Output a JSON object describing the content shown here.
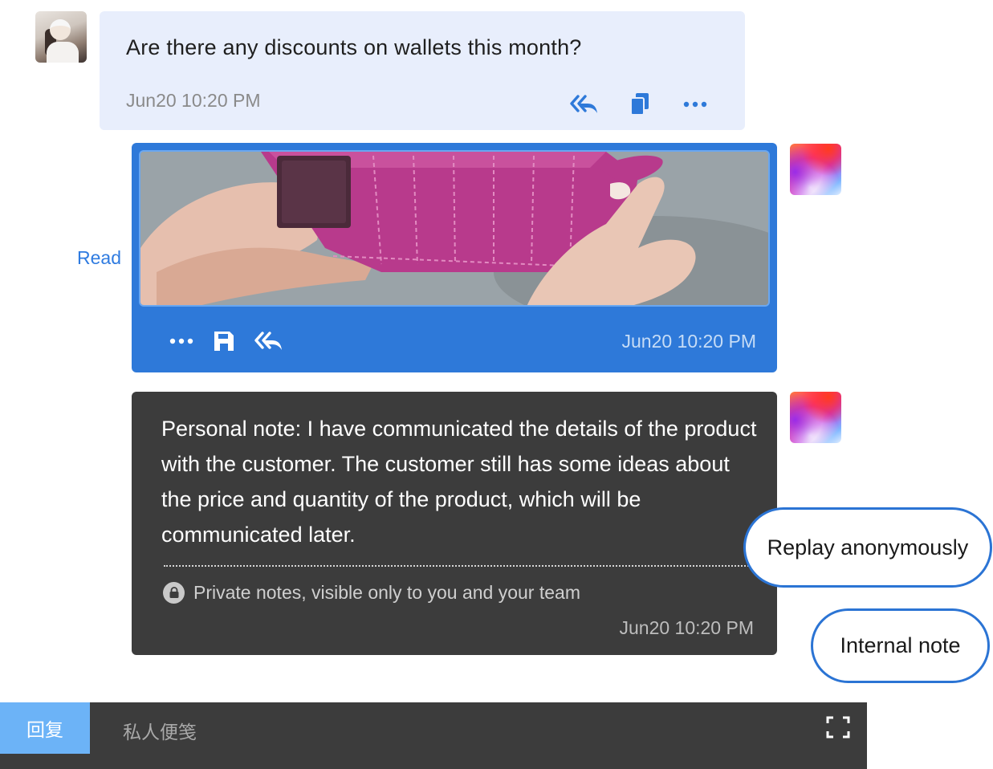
{
  "customer_message": {
    "text": "Are there any discounts on wallets this month?",
    "time": "Jun20 10:20 PM",
    "actions": [
      "reply-all-icon",
      "copy-icon",
      "more-icon"
    ]
  },
  "status": {
    "read": "Read"
  },
  "image_message": {
    "time": "Jun20 10:20 PM",
    "actions": [
      "more-icon",
      "save-icon",
      "reply-all-icon"
    ],
    "accent_color": "#2e79d9"
  },
  "note_message": {
    "text": "Personal note: I have communicated the details of the product with the customer. The customer still has some ideas about the price and quantity of the product, which will be communicated later.",
    "private_label": "Private notes, visible only to you and your team",
    "time": "Jun20 10:20 PM",
    "background_color": "#3c3c3c"
  },
  "callouts": {
    "replay_anonymously": "Replay anonymously",
    "internal_note": "Internal note"
  },
  "tabs": {
    "reply": "回复",
    "private_note": "私人便笺"
  }
}
